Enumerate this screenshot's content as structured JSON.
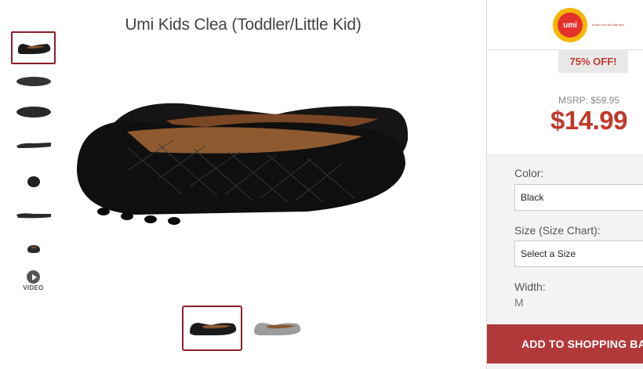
{
  "product": {
    "title": "Umi Kids Clea (Toddler/Little Kid)"
  },
  "gallery": {
    "thumbnails": [
      {
        "name": "side-view",
        "selected": true
      },
      {
        "name": "side-view-left"
      },
      {
        "name": "bottom-view"
      },
      {
        "name": "profile-view"
      },
      {
        "name": "front-view"
      },
      {
        "name": "profile-view-right"
      },
      {
        "name": "back-view"
      }
    ],
    "video_label": "VIDEO",
    "video_icon": "play-icon"
  },
  "colors": [
    {
      "name": "black",
      "hex": "#1a1a1a",
      "selected": true
    },
    {
      "name": "silver",
      "hex": "#9c9c9c"
    }
  ],
  "brand": {
    "logo_text": "umi",
    "tagline": "a little love for little feet"
  },
  "pricing": {
    "discount": "75% OFF!",
    "msrp": "MSRP: $59.95",
    "price": "$14.99"
  },
  "options": {
    "color_label": "Color:",
    "color_value": "Black",
    "size_label": "Size (Size Chart):",
    "size_value": "Select a Size",
    "width_label": "Width:",
    "width_value": "M"
  },
  "actions": {
    "add_to_bag": "ADD TO SHOPPING BAG"
  },
  "theme": {
    "accent": "#b2393a",
    "price_color": "#c0392b",
    "selected_border": "#8b1f2b"
  }
}
